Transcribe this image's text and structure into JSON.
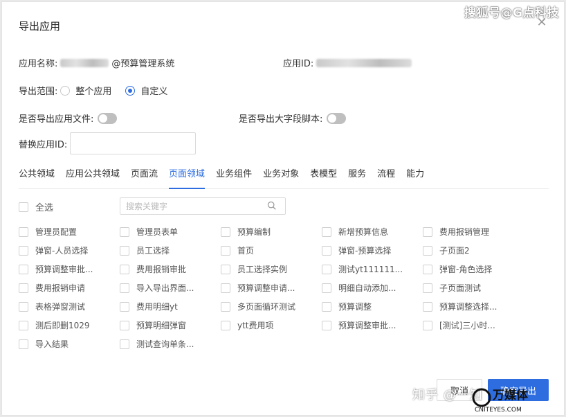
{
  "watermark_top": "搜狐号@G点科技",
  "dialog": {
    "title": "导出应用",
    "close_icon": "close-icon"
  },
  "form": {
    "app_name_label": "应用名称:",
    "app_name_value_suffix": "@预算管理系统",
    "app_id_label": "应用ID:",
    "export_scope_label": "导出范围:",
    "scope_options": [
      "整个应用",
      "自定义"
    ],
    "scope_selected": "自定义",
    "export_app_file_label": "是否导出应用文件:",
    "export_big_field_label": "是否导出大字段脚本:",
    "replace_app_id_label": "替换应用ID:"
  },
  "tabs": [
    "公共领域",
    "应用公共领域",
    "页面流",
    "页面领域",
    "业务组件",
    "业务对象",
    "表模型",
    "服务",
    "流程",
    "能力"
  ],
  "active_tab": "页面领域",
  "select_all_label": "全选",
  "search_placeholder": "搜索关键字",
  "items": [
    [
      "管理员配置",
      "管理员表单",
      "预算编制",
      "新增预算信息",
      "费用报销管理"
    ],
    [
      "弹窗-人员选择",
      "员工选择",
      "首页",
      "弹窗-预算选择",
      "子页面2"
    ],
    [
      "预算调整审批...",
      "费用报销审批",
      "员工选择实例",
      "测试yt111111...",
      "弹窗-角色选择"
    ],
    [
      "费用报销申请",
      "导入导出界面...",
      "预算调整申请...",
      "明细自动添加...",
      "子页面测试"
    ],
    [
      "表格弹窗测试",
      "费用明细yt",
      "多页面循环测试",
      "预算调整",
      "预算调整选择..."
    ],
    [
      "测后即删1029",
      "预算明细弹窗",
      "ytt费用项",
      "预算调整审批...",
      "[测试]三小时..."
    ],
    [
      "导入结果",
      "测试查询单条...",
      "",
      "",
      ""
    ]
  ],
  "buttons": {
    "cancel": "取消",
    "confirm": "确定导出"
  },
  "watermark_bottom": "知乎 @一知",
  "watermark_logo_text": "万媒体",
  "watermark_logo_sub": "CNITEYES.COM",
  "colors": {
    "accent": "#2d6de0",
    "toggle_off": "#bfbfbf"
  }
}
